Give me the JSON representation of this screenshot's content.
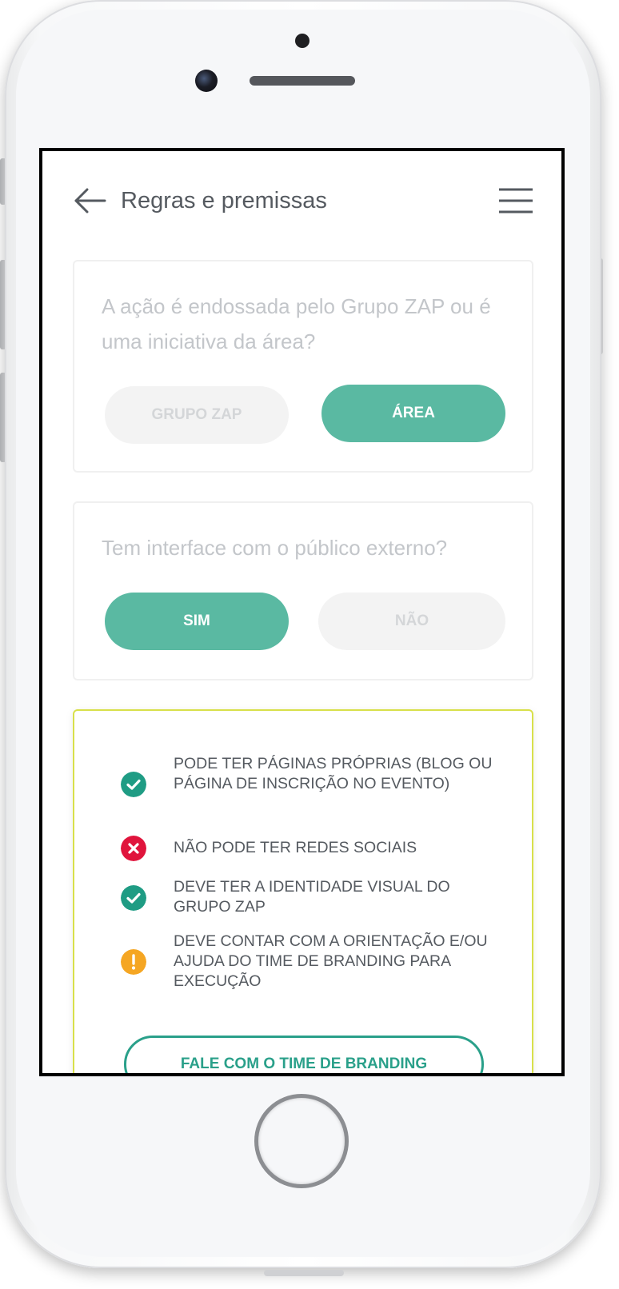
{
  "header": {
    "title": "Regras e premissas",
    "back_icon": "arrow-left-icon",
    "menu_icon": "hamburger-menu-icon"
  },
  "question1": {
    "text": "A ação é endossada pelo Grupo ZAP ou é uma iniciativa da área?",
    "options": [
      "GRUPO ZAP",
      "ÁREA"
    ],
    "selected": "ÁREA"
  },
  "question2": {
    "text": "Tem interface com o público externo?",
    "options": [
      "SIM",
      "NÃO"
    ],
    "selected": "SIM"
  },
  "rules": [
    {
      "status": "allowed",
      "icon": "check-circle-icon",
      "text": "PODE TER PÁGINAS PRÓPRIAS (BLOG OU PÁGINA DE INSCRIÇÃO NO EVENTO)"
    },
    {
      "status": "forbidden",
      "icon": "x-circle-icon",
      "text": "NÃO PODE TER REDES SOCIAIS"
    },
    {
      "status": "allowed",
      "icon": "check-circle-icon",
      "text": "DEVE TER A IDENTIDADE VISUAL DO GRUPO ZAP"
    },
    {
      "status": "warning",
      "icon": "exclamation-circle-icon",
      "text": "DEVE CONTAR COM A ORIENTAÇÃO E/OU AJUDA DO TIME DE BRANDING PARA EXECUÇÃO"
    }
  ],
  "cta": {
    "label": "FALE COM O TIME DE BRANDING"
  },
  "colors": {
    "accent": "#5ab9a2",
    "cta_border": "#2aa08a",
    "allowed": "#1f9c84",
    "forbidden": "#e0143c",
    "warning": "#f5a623",
    "result_border": "#d8e04a"
  }
}
